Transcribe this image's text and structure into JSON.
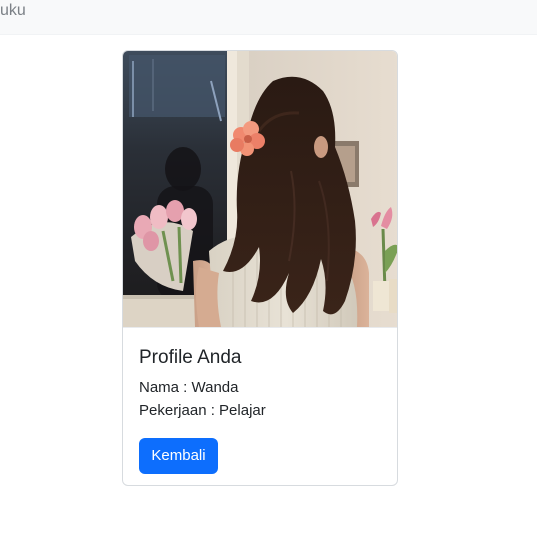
{
  "navbar": {
    "brand": "uku"
  },
  "card": {
    "photo_alt": "Photo of a girl with long dark hair and a peach flower hair clip holding pink tulips",
    "title": "Profile Anda",
    "nama_line": "Nama : Wanda",
    "pekerjaan_line": "Pekerjaan : Pelajar",
    "back_button": "Kembali"
  },
  "colors": {
    "navbar_bg": "#f8f9fa",
    "button_bg": "#0d6efd",
    "button_text": "#ffffff",
    "card_border": "#d7dbdf"
  }
}
